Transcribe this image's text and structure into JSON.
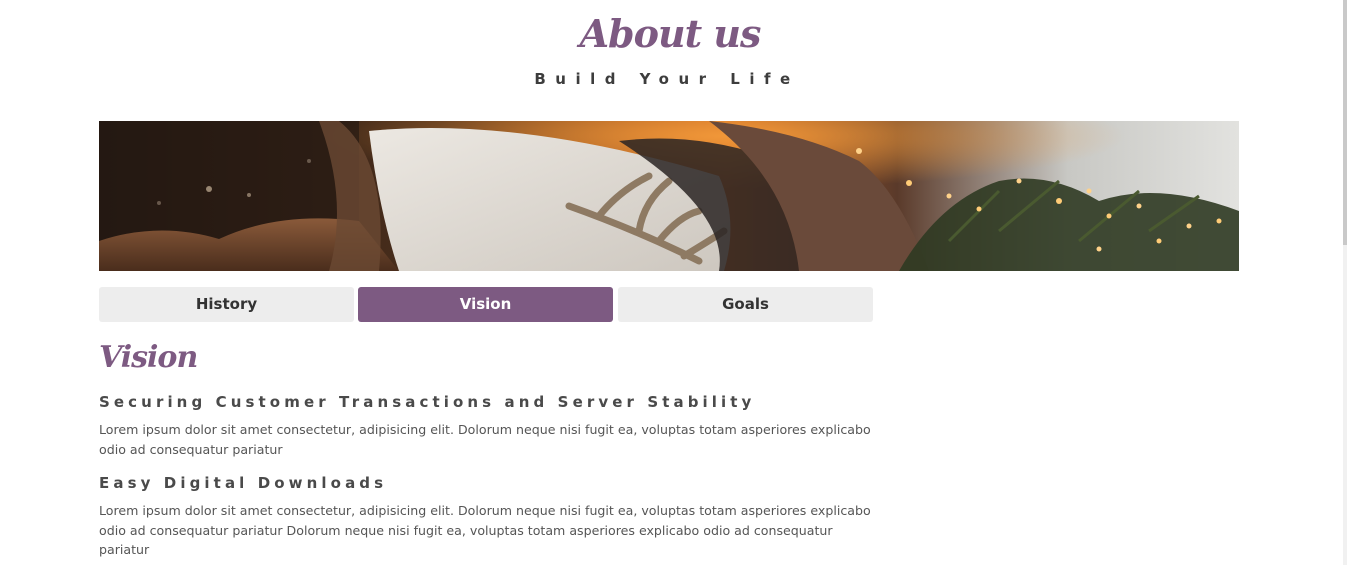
{
  "hero": {
    "title": "About us",
    "subtitle": "Build Your Life"
  },
  "banner": {
    "image": "cozy-pillow-fur-lights-photo"
  },
  "tabs": [
    {
      "label": "History",
      "active": false
    },
    {
      "label": "Vision",
      "active": true
    },
    {
      "label": "Goals",
      "active": false
    }
  ],
  "content": {
    "title": "Vision",
    "items": [
      {
        "heading": "Securing Customer Transactions and Server Stability",
        "body": "Lorem ipsum dolor sit amet consectetur, adipisicing elit. Dolorum neque nisi fugit ea, voluptas totam asperiores explicabo odio ad consequatur pariatur"
      },
      {
        "heading": "Easy Digital Downloads",
        "body": "Lorem ipsum dolor sit amet consectetur, adipisicing elit. Dolorum neque nisi fugit ea, voluptas totam asperiores explicabo odio ad consequatur pariatur Dolorum neque nisi fugit ea, voluptas totam asperiores explicabo odio ad consequatur pariatur"
      }
    ]
  },
  "colors": {
    "accent": "#7d5a82",
    "tab_inactive": "#ededed",
    "heading_text": "#4a4a4a",
    "body_text": "#555555"
  }
}
